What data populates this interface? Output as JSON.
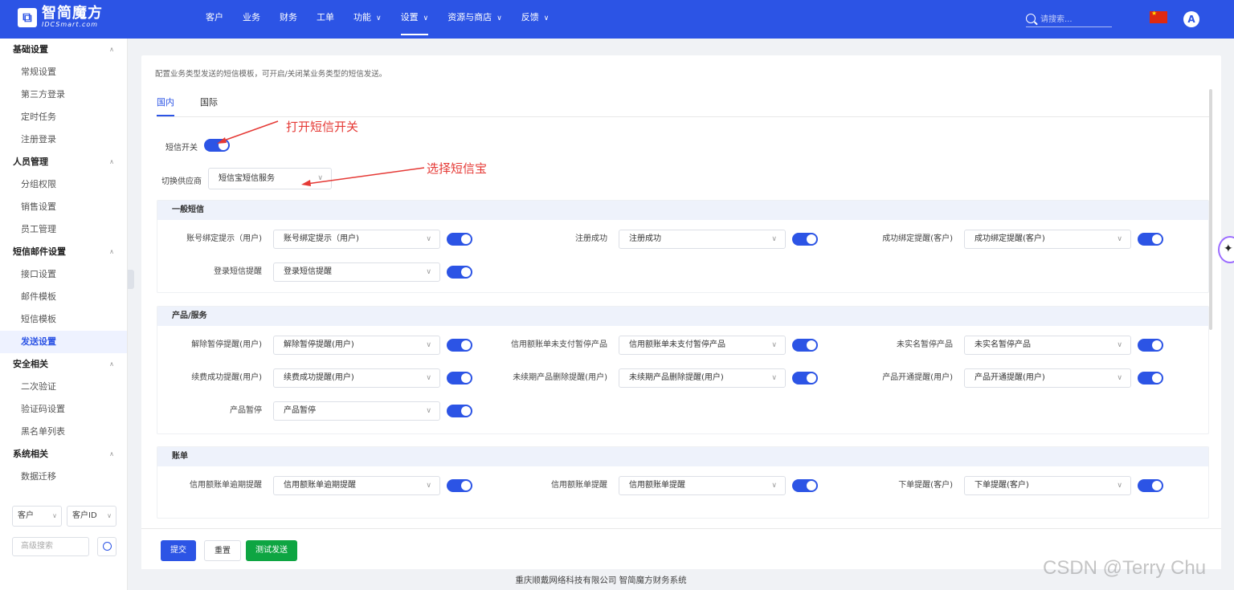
{
  "brand": {
    "name": "智简魔方",
    "sub": "IDCSmart.com"
  },
  "nav": [
    {
      "label": "客户",
      "dropdown": false,
      "active": false
    },
    {
      "label": "业务",
      "dropdown": false,
      "active": false
    },
    {
      "label": "财务",
      "dropdown": false,
      "active": false
    },
    {
      "label": "工单",
      "dropdown": false,
      "active": false
    },
    {
      "label": "功能",
      "dropdown": true,
      "active": false
    },
    {
      "label": "设置",
      "dropdown": true,
      "active": true
    },
    {
      "label": "资源与商店",
      "dropdown": true,
      "active": false
    },
    {
      "label": "反馈",
      "dropdown": true,
      "active": false
    }
  ],
  "search": {
    "placeholder": "请搜索..."
  },
  "avatar": "A",
  "sidebar": [
    {
      "group": "基础设置",
      "items": [
        "常规设置",
        "第三方登录",
        "定时任务",
        "注册登录"
      ]
    },
    {
      "group": "人员管理",
      "items": [
        "分组权限",
        "销售设置",
        "员工管理"
      ]
    },
    {
      "group": "短信邮件设置",
      "items": [
        "接口设置",
        "邮件模板",
        "短信模板",
        "发送设置"
      ]
    },
    {
      "group": "安全相关",
      "items": [
        "二次验证",
        "验证码设置",
        "黑名单列表"
      ]
    },
    {
      "group": "系统相关",
      "items": [
        "数据迁移"
      ]
    }
  ],
  "sidebar_active": "发送设置",
  "sidebar_bottom": {
    "select1": "客户",
    "select2": "客户ID",
    "search_placeholder": "高级搜索"
  },
  "page": {
    "description": "配置业务类型发送的短信模板，可开启/关闭某业务类型的短信发送。",
    "tabs": [
      "国内",
      "国际"
    ],
    "active_tab": "国内",
    "sms_switch_label": "短信开关",
    "provider_label": "切换供应商",
    "provider_value": "短信宝短信服务"
  },
  "annotations": {
    "switch_note": "打开短信开关",
    "provider_note": "选择短信宝"
  },
  "sections": [
    {
      "title": "一般短信",
      "rows": [
        [
          {
            "label": "账号绑定提示（用户)",
            "value": "账号绑定提示（用户)"
          },
          {
            "label": "注册成功",
            "value": "注册成功"
          },
          {
            "label": "成功绑定提醒(客户)",
            "value": "成功绑定提醒(客户)"
          }
        ],
        [
          {
            "label": "登录短信提醒",
            "value": "登录短信提醒"
          }
        ]
      ]
    },
    {
      "title": "产品/服务",
      "rows": [
        [
          {
            "label": "解除暂停提醒(用户)",
            "value": "解除暂停提醒(用户)"
          },
          {
            "label": "信用额账单未支付暂停产品",
            "value": "信用额账单未支付暂停产品"
          },
          {
            "label": "未实名暂停产品",
            "value": "未实名暂停产品"
          }
        ],
        [
          {
            "label": "续费成功提醒(用户)",
            "value": "续费成功提醒(用户)"
          },
          {
            "label": "未续期产品删除提醒(用户)",
            "value": "未续期产品删除提醒(用户)"
          },
          {
            "label": "产品开通提醒(用户)",
            "value": "产品开通提醒(用户)"
          }
        ],
        [
          {
            "label": "产品暂停",
            "value": "产品暂停"
          }
        ]
      ]
    },
    {
      "title": "账单",
      "rows": [
        [
          {
            "label": "信用额账单逾期提醒",
            "value": "信用额账单逾期提醒"
          },
          {
            "label": "信用额账单提醒",
            "value": "信用额账单提醒"
          },
          {
            "label": "下单提醒(客户)",
            "value": "下单提醒(客户)"
          }
        ]
      ]
    }
  ],
  "buttons": {
    "submit": "提交",
    "reset": "重置",
    "test": "测试发送"
  },
  "footer": "重庆顺戴网络科技有限公司 智简魔方财务系统",
  "watermark": "CSDN @Terry Chu",
  "colors": {
    "primary": "#2c54e5",
    "success": "#0ea542",
    "annotation": "#e53935"
  }
}
